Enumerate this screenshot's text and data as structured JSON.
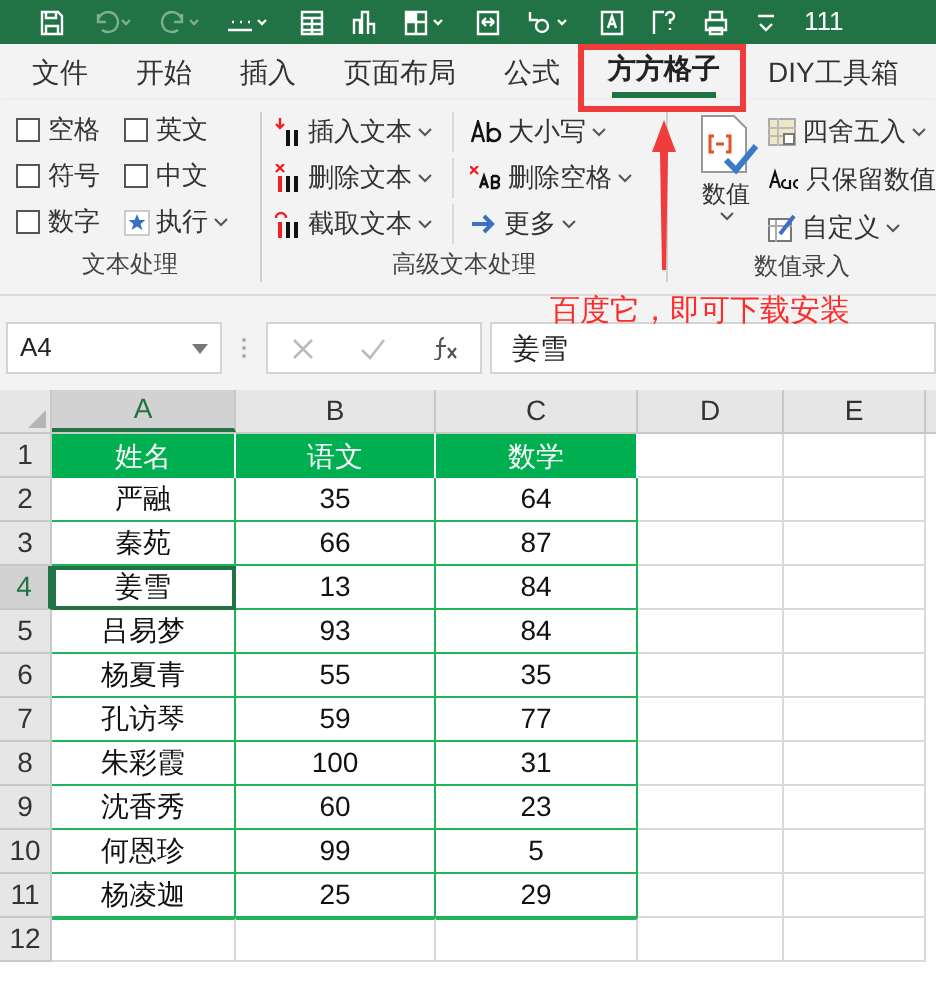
{
  "title_bar": {
    "text": "111"
  },
  "tabs": [
    {
      "label": "文件",
      "selected": false
    },
    {
      "label": "开始",
      "selected": false
    },
    {
      "label": "插入",
      "selected": false
    },
    {
      "label": "页面布局",
      "selected": false
    },
    {
      "label": "公式",
      "selected": false
    },
    {
      "label": "方方格子",
      "selected": true
    },
    {
      "label": "DIY工具箱",
      "selected": false
    }
  ],
  "text_group": {
    "label": "文本处理",
    "checkboxes": [
      {
        "label": "空格",
        "checked": false
      },
      {
        "label": "英文",
        "checked": false
      },
      {
        "label": "符号",
        "checked": false
      },
      {
        "label": "中文",
        "checked": false
      },
      {
        "label": "数字",
        "checked": false
      }
    ],
    "run_button": {
      "label": "执行"
    }
  },
  "advanced_group": {
    "label": "高级文本处理",
    "buttons": [
      {
        "kind": "insert",
        "label": "插入文本"
      },
      {
        "kind": "case",
        "label": "大小写"
      },
      {
        "kind": "delete",
        "label": "删除文本"
      },
      {
        "kind": "trim",
        "label": "删除空格"
      },
      {
        "kind": "cut",
        "label": "截取文本"
      },
      {
        "kind": "more",
        "label": "更多"
      }
    ]
  },
  "number_group": {
    "label": "数值录入",
    "big_button": {
      "label": "数值"
    },
    "buttons": [
      {
        "kind": "round",
        "label": "四舍五入",
        "dropdown": true
      },
      {
        "kind": "keep",
        "label": "只保留数值",
        "dropdown": false
      },
      {
        "kind": "custom",
        "label": "自定义",
        "dropdown": true
      }
    ]
  },
  "annotation": {
    "text": "百度它，即可下载安装"
  },
  "name_box": {
    "value": "A4"
  },
  "formula_bar": {
    "value": "姜雪"
  },
  "sheet": {
    "columns": [
      {
        "label": "A",
        "selected": true
      },
      {
        "label": "B",
        "selected": false
      },
      {
        "label": "C",
        "selected": false
      },
      {
        "label": "D",
        "selected": false
      },
      {
        "label": "E",
        "selected": false
      }
    ],
    "rows": [
      {
        "number": "1",
        "selected": false,
        "kind": "header",
        "cells": [
          "姓名",
          "语文",
          "数学"
        ]
      },
      {
        "number": "2",
        "selected": false,
        "kind": "data",
        "cells": [
          "严融",
          "35",
          "64"
        ]
      },
      {
        "number": "3",
        "selected": false,
        "kind": "data",
        "cells": [
          "秦苑",
          "66",
          "87"
        ]
      },
      {
        "number": "4",
        "selected": true,
        "kind": "data",
        "cells": [
          "姜雪",
          "13",
          "84"
        ]
      },
      {
        "number": "5",
        "selected": false,
        "kind": "data",
        "cells": [
          "吕易梦",
          "93",
          "84"
        ]
      },
      {
        "number": "6",
        "selected": false,
        "kind": "data",
        "cells": [
          "杨夏青",
          "55",
          "35"
        ]
      },
      {
        "number": "7",
        "selected": false,
        "kind": "data",
        "cells": [
          "孔访琴",
          "59",
          "77"
        ]
      },
      {
        "number": "8",
        "selected": false,
        "kind": "data",
        "cells": [
          "朱彩霞",
          "100",
          "31"
        ]
      },
      {
        "number": "9",
        "selected": false,
        "kind": "data",
        "cells": [
          "沈香秀",
          "60",
          "23"
        ]
      },
      {
        "number": "10",
        "selected": false,
        "kind": "data",
        "cells": [
          "何恩珍",
          "99",
          "5"
        ]
      },
      {
        "number": "11",
        "selected": false,
        "kind": "data",
        "cells": [
          "杨凌迦",
          "25",
          "29"
        ]
      },
      {
        "number": "12",
        "selected": false,
        "kind": "empty"
      }
    ]
  }
}
